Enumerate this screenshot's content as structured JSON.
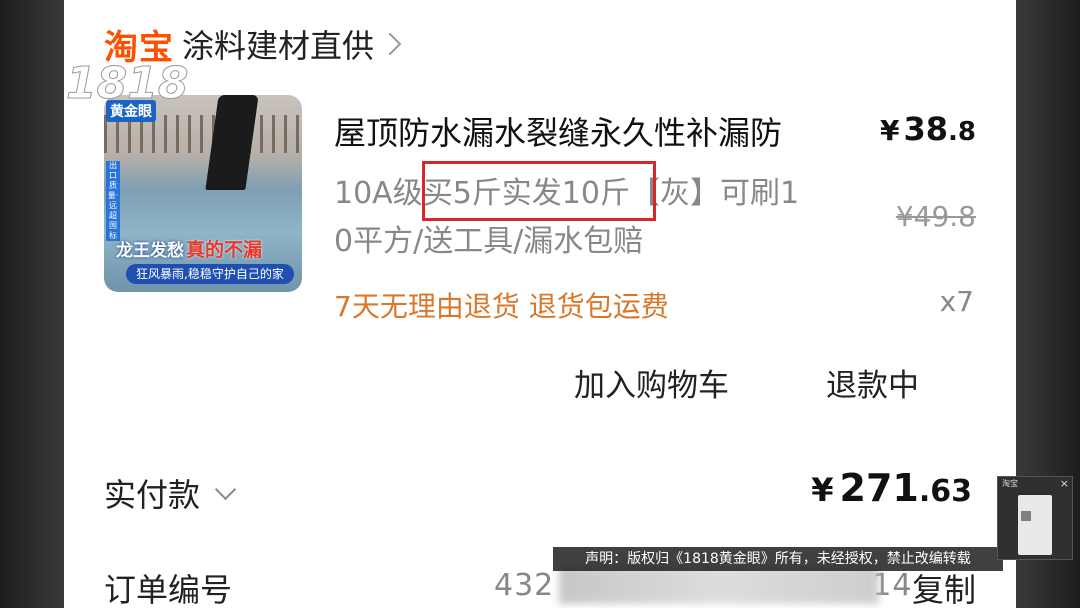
{
  "shop": {
    "platform": "淘宝",
    "name": "涂料建材直供"
  },
  "product": {
    "title": "屋顶防水漏水裂缝永久性补漏防",
    "price_currency": "¥",
    "price_int": "38",
    "price_dec": ".8",
    "spec_line1": "10A级买5斤实发10斤【灰】可刷1",
    "spec_line2": "0平方/送工具/漏水包赔",
    "original_price": "¥49.8",
    "promise": "7天无理由退货  退货包运费",
    "quantity": "x7",
    "thumb_banner_a": "龙王发愁",
    "thumb_banner_b": "真的不漏",
    "thumb_sub": "狂风暴雨,稳稳守护自己的家",
    "thumb_side_tag": "出口质量·远超国标"
  },
  "actions": {
    "add_cart": "加入购物车",
    "refund": "退款中"
  },
  "payment": {
    "label": "实付款",
    "currency": "¥",
    "amount_int": "271",
    "amount_dec": ".63"
  },
  "order": {
    "label": "订单编号",
    "number_visible": "432",
    "number_tail": "14",
    "copy": "复制"
  },
  "watermark": {
    "number": "1818",
    "label": "黄金眼"
  },
  "disclaimer": "声明：版权归《1818黄金眼》所有，未经授权，禁止改编转载",
  "mini_window": {
    "title": "淘宝",
    "close": "×"
  },
  "colors": {
    "accent_orange": "#ff5000",
    "promise": "#d9782b",
    "highlight_box": "#d8272b"
  }
}
